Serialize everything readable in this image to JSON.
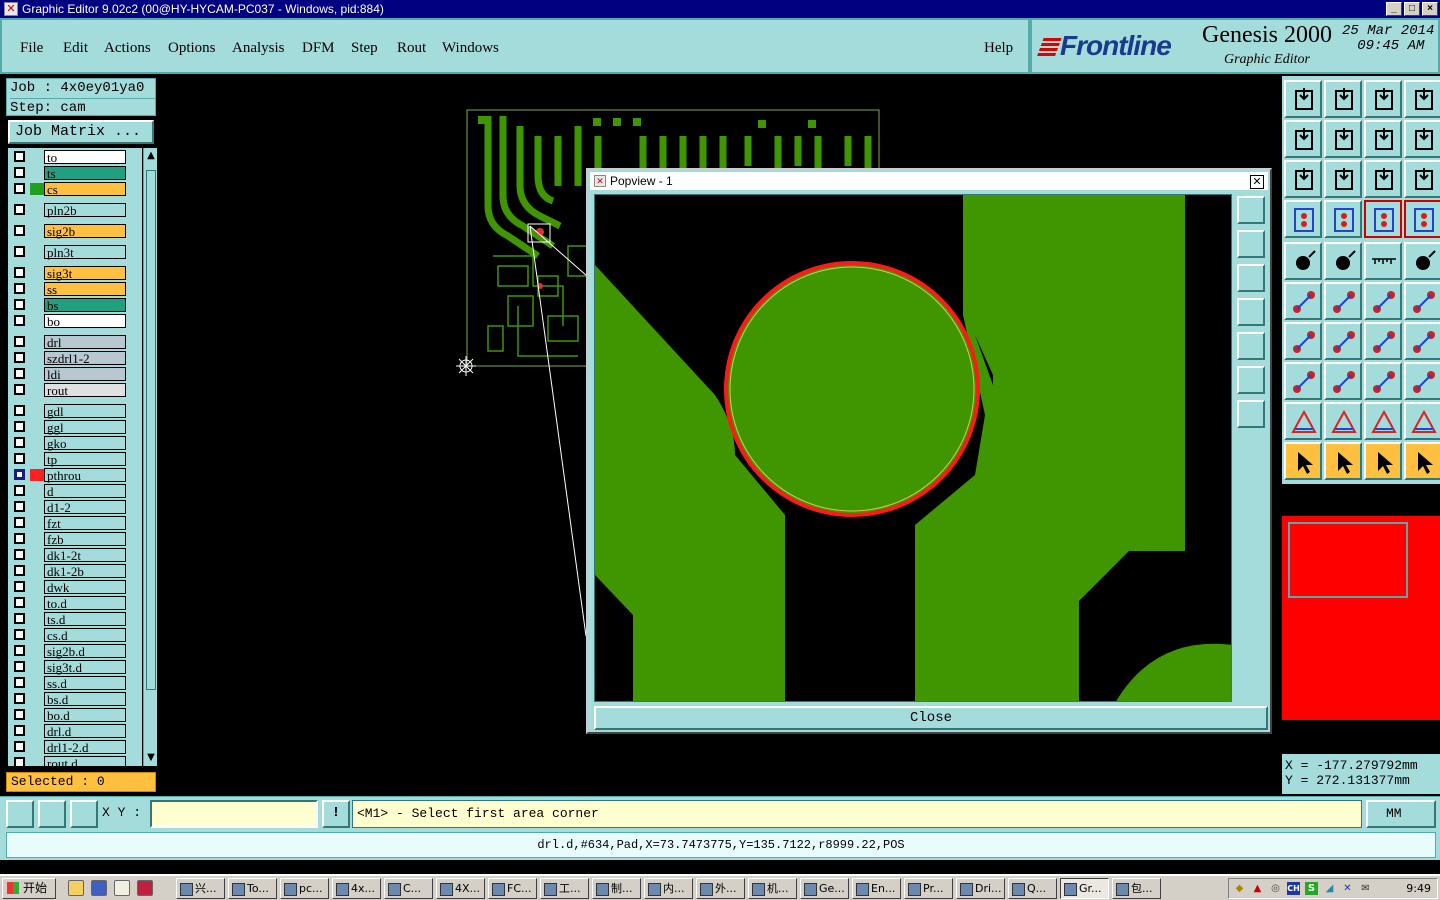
{
  "window": {
    "title": "Graphic Editor 9.02c2 (00@HY-HYCAM-PC037 - Windows, pid:884)",
    "buttons": [
      "_",
      "□",
      "×"
    ]
  },
  "menu": [
    "File",
    "Edit",
    "Actions",
    "Options",
    "Analysis",
    "DFM",
    "Step",
    "Rout",
    "Windows"
  ],
  "help_label": "Help",
  "brand": {
    "logo": "Frontline",
    "product": "Genesis 2000",
    "subtitle": "Graphic Editor",
    "date": "25 Mar 2014",
    "time": "09:45 AM"
  },
  "job": {
    "job_line": "Job : 4x0ey01ya0",
    "step_line": "Step: cam"
  },
  "job_matrix_label": "Job Matrix ...",
  "layers": [
    {
      "name": "to",
      "color": "#ffffff",
      "swatch": "",
      "pen": false,
      "selected": false
    },
    {
      "name": "ts",
      "color": "#20a080",
      "swatch": "",
      "pen": true,
      "selected": false
    },
    {
      "name": "cs",
      "color": "#ffc040",
      "swatch": "#20a020",
      "pen": true,
      "selected": false
    },
    {
      "name": "pln2b",
      "color": "#a4dcdc",
      "swatch": "",
      "pen": false,
      "selected": false
    },
    {
      "name": "sig2b",
      "color": "#ffc040",
      "swatch": "",
      "pen": true,
      "selected": false
    },
    {
      "name": "pln3t",
      "color": "#a4dcdc",
      "swatch": "",
      "pen": false,
      "selected": false
    },
    {
      "name": "sig3t",
      "color": "#ffc040",
      "swatch": "",
      "pen": true,
      "selected": false
    },
    {
      "name": "ss",
      "color": "#ffc040",
      "swatch": "",
      "pen": true,
      "selected": false
    },
    {
      "name": "bs",
      "color": "#20a080",
      "swatch": "",
      "pen": true,
      "selected": false
    },
    {
      "name": "bo",
      "color": "#ffffff",
      "swatch": "",
      "pen": false,
      "selected": false
    },
    {
      "name": "drl",
      "color": "#b8c8d0",
      "swatch": "",
      "pen": false,
      "selected": false
    },
    {
      "name": "szdrl1-2",
      "color": "#b8c8d0",
      "swatch": "",
      "pen": false,
      "selected": false
    },
    {
      "name": "ldi",
      "color": "#b8c8d0",
      "swatch": "",
      "pen": false,
      "selected": false
    },
    {
      "name": "rout",
      "color": "#e0e0e0",
      "swatch": "",
      "pen": false,
      "selected": false
    },
    {
      "name": "gdl",
      "color": "#a4dcdc",
      "swatch": "",
      "pen": false,
      "selected": false
    },
    {
      "name": "ggl",
      "color": "#a4dcdc",
      "swatch": "",
      "pen": false,
      "selected": false
    },
    {
      "name": "gko",
      "color": "#a4dcdc",
      "swatch": "",
      "pen": false,
      "selected": false
    },
    {
      "name": "tp",
      "color": "#a4dcdc",
      "swatch": "",
      "pen": true,
      "selected": false
    },
    {
      "name": "pthrou",
      "color": "#a4dcdc",
      "swatch": "#ff2020",
      "pen": false,
      "selected": true
    },
    {
      "name": "d",
      "color": "#a4dcdc",
      "swatch": "",
      "pen": false,
      "selected": false
    },
    {
      "name": "d1-2",
      "color": "#a4dcdc",
      "swatch": "",
      "pen": false,
      "selected": false
    },
    {
      "name": "fzt",
      "color": "#a4dcdc",
      "swatch": "",
      "pen": false,
      "selected": false
    },
    {
      "name": "fzb",
      "color": "#a4dcdc",
      "swatch": "",
      "pen": false,
      "selected": false
    },
    {
      "name": "dk1-2t",
      "color": "#a4dcdc",
      "swatch": "",
      "pen": false,
      "selected": false
    },
    {
      "name": "dk1-2b",
      "color": "#a4dcdc",
      "swatch": "",
      "pen": false,
      "selected": false
    },
    {
      "name": "dwk",
      "color": "#a4dcdc",
      "swatch": "",
      "pen": false,
      "selected": false
    },
    {
      "name": "to.d",
      "color": "#a4dcdc",
      "swatch": "",
      "pen": false,
      "selected": false
    },
    {
      "name": "ts.d",
      "color": "#a4dcdc",
      "swatch": "",
      "pen": true,
      "selected": false
    },
    {
      "name": "cs.d",
      "color": "#a4dcdc",
      "swatch": "",
      "pen": true,
      "selected": false
    },
    {
      "name": "sig2b.d",
      "color": "#a4dcdc",
      "swatch": "",
      "pen": true,
      "selected": false
    },
    {
      "name": "sig3t.d",
      "color": "#a4dcdc",
      "swatch": "",
      "pen": true,
      "selected": false
    },
    {
      "name": "ss.d",
      "color": "#a4dcdc",
      "swatch": "",
      "pen": true,
      "selected": false
    },
    {
      "name": "bs.d",
      "color": "#a4dcdc",
      "swatch": "",
      "pen": true,
      "selected": false
    },
    {
      "name": "bo.d",
      "color": "#a4dcdc",
      "swatch": "",
      "pen": false,
      "selected": false
    },
    {
      "name": "drl.d",
      "color": "#a4dcdc",
      "swatch": "",
      "pen": false,
      "selected": false
    },
    {
      "name": "drl1-2.d",
      "color": "#a4dcdc",
      "swatch": "",
      "pen": false,
      "selected": false
    },
    {
      "name": "rout.d",
      "color": "#a4dcdc",
      "swatch": "",
      "pen": false,
      "selected": false
    }
  ],
  "selected_label": "Selected : 0",
  "popview": {
    "title": "Popview - 1",
    "close_label": "Close"
  },
  "coords": {
    "x": "X = -177.279792mm",
    "y": "Y = 272.131377mm"
  },
  "bottom": {
    "xy_label": "X Y :",
    "xy_value": "",
    "prompt": "<M1> - Select first area corner",
    "unit": "MM"
  },
  "status_line": "drl.d,#634,Pad,X=73.7473775,Y=135.7122,r8999.22,POS",
  "taskbar": {
    "start": "开始",
    "tasks": [
      "兴...",
      "To...",
      "pc...",
      "4x...",
      "C...",
      "4X...",
      "FC...",
      "工...",
      "制...",
      "内...",
      "外...",
      "机...",
      "Ge...",
      "En...",
      "Pr...",
      "Dri...",
      "Q...",
      "Gr...",
      "包..."
    ],
    "active_task": "Gr...",
    "clock": "9:49"
  },
  "colors": {
    "copper": "#3f9600",
    "pad_ring": "#ff1a1a",
    "panel": "#a4dcdc",
    "accent": "#ffc040"
  }
}
